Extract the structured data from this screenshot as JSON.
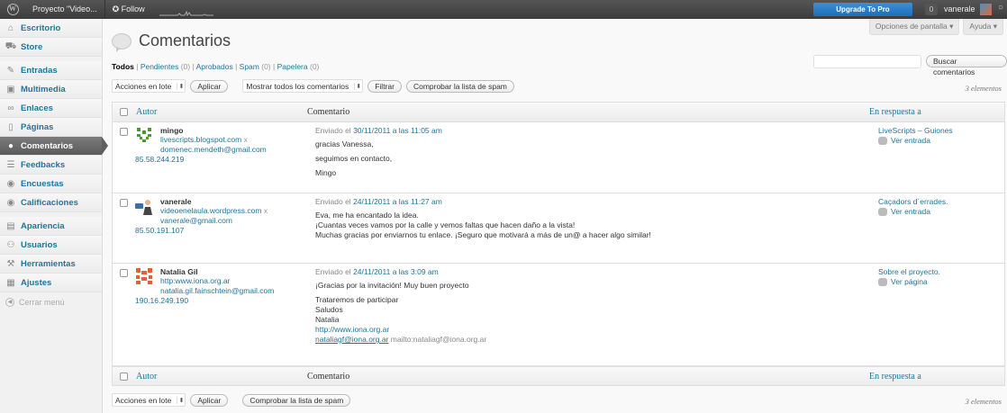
{
  "adminbar": {
    "site_name": "Proyecto \"Video...",
    "follow": "✪ Follow",
    "upgrade": "Upgrade To Pro",
    "notifications": "0",
    "user": "vanerale"
  },
  "sidebar": {
    "items": [
      {
        "label": "Escritorio",
        "icon": "home-icon"
      },
      {
        "label": "Store",
        "icon": "cart-icon"
      },
      {
        "label": "Entradas",
        "icon": "pin-icon"
      },
      {
        "label": "Multimedia",
        "icon": "media-icon"
      },
      {
        "label": "Enlaces",
        "icon": "link-icon"
      },
      {
        "label": "Páginas",
        "icon": "page-icon"
      },
      {
        "label": "Comentarios",
        "icon": "comment-icon"
      },
      {
        "label": "Feedbacks",
        "icon": "feedback-icon"
      },
      {
        "label": "Encuestas",
        "icon": "poll-icon"
      },
      {
        "label": "Calificaciones",
        "icon": "rating-icon"
      },
      {
        "label": "Apariencia",
        "icon": "appearance-icon"
      },
      {
        "label": "Usuarios",
        "icon": "users-icon"
      },
      {
        "label": "Herramientas",
        "icon": "tools-icon"
      },
      {
        "label": "Ajustes",
        "icon": "settings-icon"
      }
    ],
    "collapse": "Cerrar menú"
  },
  "screen_options": "Opciones de pantalla ▾",
  "help": "Ayuda ▾",
  "page_title": "Comentarios",
  "filters": {
    "all": "Todos",
    "pending": "Pendientes",
    "pending_count": "(0)",
    "approved": "Aprobados",
    "spam": "Spam",
    "spam_count": "(0)",
    "trash": "Papelera",
    "trash_count": "(0)",
    "sep": " | "
  },
  "search": {
    "button": "Buscar comentarios",
    "value": ""
  },
  "toolbar": {
    "bulk": "Acciones en lote",
    "apply": "Aplicar",
    "show_all": "Mostrar todos los comentarios",
    "filter": "Filtrar",
    "check_spam": "Comprobar la lista de spam",
    "count": "3 elementos"
  },
  "table": {
    "col_author": "Autor",
    "col_comment": "Comentario",
    "col_reply": "En respuesta a",
    "rows": [
      {
        "name": "mingo",
        "url": "livescripts.blogspot.com",
        "email": "domenec.mendeth@gmail.com",
        "ip": "85.58.244.219",
        "submitted_prefix": "Enviado el ",
        "submitted_date": "30/11/2011 a las 11:05 am",
        "lines": [
          "gracias Vanessa,",
          "seguimos en contacto,",
          "Mingo"
        ],
        "reply_title": "LiveScripts – Guiones",
        "reply_link": "Ver entrada"
      },
      {
        "name": "vanerale",
        "url": "videoenelaula.wordpress.com",
        "email": "vanerale@gmail.com",
        "ip": "85.50.191.107",
        "submitted_prefix": "Enviado el ",
        "submitted_date": "24/11/2011 a las 11:27 am",
        "lines": [
          "Eva, me ha encantado la idea.",
          "¡Cuantas veces vamos por la calle y vemos faltas que hacen daño a la vista!",
          "Muchas gracias por enviarnos tu enlace. ¡Seguro que motivará a más de un@ a hacer algo similar!"
        ],
        "reply_title": "Caçadors d´errades.",
        "reply_link": "Ver entrada"
      },
      {
        "name": "Natalia Gil",
        "url": "http:www.iona.org.ar",
        "email": "natalia.gil.fainschtein@gmail.com",
        "ip": "190.16.249.190",
        "submitted_prefix": "Enviado el ",
        "submitted_date": "24/11/2011 a las 3:09 am",
        "lines": [
          "¡Gracias por la invitación! Muy buen proyecto",
          "Trataremos de participar",
          "Saludos",
          "Natalia"
        ],
        "link_url": "http://www.iona.org.ar",
        "mail_link": "nataliagf@iona.org.ar",
        "mail_text": " mailto:nataliagf@iona.org.ar",
        "reply_title": "Sobre el proyecto.",
        "reply_link": "Ver página"
      }
    ]
  }
}
